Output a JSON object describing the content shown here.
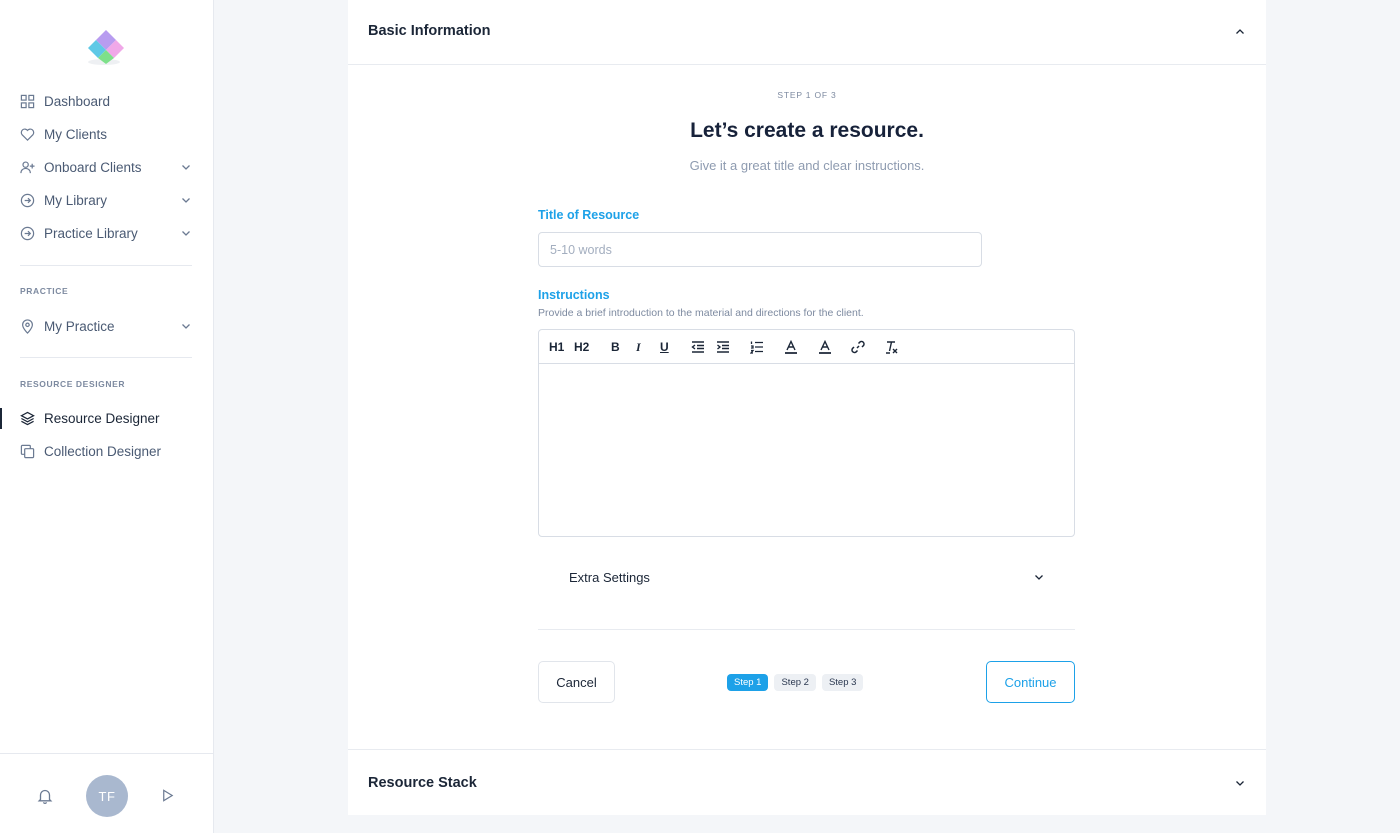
{
  "sidebar": {
    "nav": [
      {
        "label": "Dashboard",
        "icon": "grid-icon"
      },
      {
        "label": "My Clients",
        "icon": "heart-icon"
      },
      {
        "label": "Onboard Clients",
        "icon": "user-plus-icon",
        "expandable": true
      },
      {
        "label": "My Library",
        "icon": "arrow-circle-icon",
        "expandable": true
      },
      {
        "label": "Practice Library",
        "icon": "arrow-circle-icon",
        "expandable": true
      }
    ],
    "practice_section": {
      "label": "PRACTICE",
      "items": [
        {
          "label": "My Practice",
          "icon": "map-pin-icon",
          "expandable": true
        }
      ]
    },
    "designer_section": {
      "label": "RESOURCE DESIGNER",
      "items": [
        {
          "label": "Resource Designer",
          "icon": "layers-icon",
          "active": true
        },
        {
          "label": "Collection Designer",
          "icon": "copy-icon"
        }
      ]
    },
    "footer": {
      "avatar_initials": "TF"
    }
  },
  "card": {
    "header_title": "Basic Information",
    "step_label": "STEP 1 OF 3",
    "title": "Let’s create a resource.",
    "subtitle": "Give it a great title and clear instructions.",
    "title_field": {
      "label": "Title of Resource",
      "value": "",
      "placeholder": "5-10 words"
    },
    "instructions": {
      "label": "Instructions",
      "help": "Provide a brief introduction to the material and directions for the client."
    },
    "toolbar": {
      "h1": "H1",
      "h2": "H2",
      "bold": "B",
      "italic": "I",
      "underline": "U"
    },
    "extra_settings": "Extra Settings",
    "cancel": "Cancel",
    "continue": "Continue",
    "steps": [
      "Step 1",
      "Step 2",
      "Step 3"
    ],
    "stack_title": "Resource Stack"
  },
  "colors": {
    "accent": "#1da1e8",
    "text": "#1b2637",
    "muted": "#7d8aa0"
  }
}
